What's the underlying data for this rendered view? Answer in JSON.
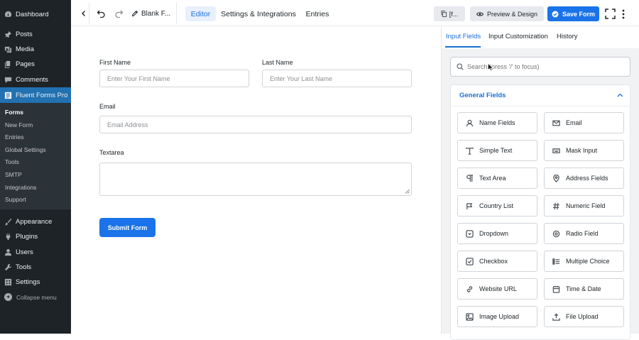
{
  "sidebar": {
    "items": [
      {
        "label": "Dashboard",
        "icon": "dashboard-icon"
      },
      {
        "label": "Posts",
        "icon": "pin-icon"
      },
      {
        "label": "Media",
        "icon": "media-icon"
      },
      {
        "label": "Pages",
        "icon": "pages-icon"
      },
      {
        "label": "Comments",
        "icon": "comments-icon"
      },
      {
        "label": "Fluent Forms Pro",
        "icon": "forms-icon"
      },
      {
        "label": "Appearance",
        "icon": "brush-icon"
      },
      {
        "label": "Plugins",
        "icon": "plugin-icon"
      },
      {
        "label": "Users",
        "icon": "users-icon"
      },
      {
        "label": "Tools",
        "icon": "wrench-icon"
      },
      {
        "label": "Settings",
        "icon": "settings-icon"
      }
    ],
    "submenu": [
      "Forms",
      "New Form",
      "Entries",
      "Global Settings",
      "Tools",
      "SMTP",
      "Integrations",
      "Support"
    ],
    "collapse_label": "Collapse menu"
  },
  "topbar": {
    "form_title": "Blank F...",
    "tabs": [
      "Editor",
      "Settings & Integrations",
      "Entries"
    ],
    "shortcode_label": "[f...",
    "preview_label": "Preview & Design",
    "save_label": "Save Form"
  },
  "form": {
    "first_name_label": "First Name",
    "first_name_placeholder": "Enter Your First Name",
    "last_name_label": "Last Name",
    "last_name_placeholder": "Enter Your Last Name",
    "email_label": "Email",
    "email_placeholder": "Email Address",
    "textarea_label": "Textarea",
    "submit_label": "Submit Form"
  },
  "panel": {
    "tabs": [
      "Input Fields",
      "Input Customization",
      "History"
    ],
    "search_placeholder": "Search (press '/' to focus)",
    "section_title": "General Fields",
    "fields": [
      {
        "label": "Name Fields",
        "icon": "user-icon"
      },
      {
        "label": "Email",
        "icon": "envelope-icon"
      },
      {
        "label": "Simple Text",
        "icon": "text-icon"
      },
      {
        "label": "Mask Input",
        "icon": "keyboard-icon"
      },
      {
        "label": "Text Area",
        "icon": "paragraph-icon"
      },
      {
        "label": "Address Fields",
        "icon": "location-pin-icon"
      },
      {
        "label": "Country List",
        "icon": "flag-icon"
      },
      {
        "label": "Numeric Field",
        "icon": "hash-icon"
      },
      {
        "label": "Dropdown",
        "icon": "dropdown-icon"
      },
      {
        "label": "Radio Field",
        "icon": "radio-icon"
      },
      {
        "label": "Checkbox",
        "icon": "checkbox-icon"
      },
      {
        "label": "Multiple Choice",
        "icon": "list-icon"
      },
      {
        "label": "Website URL",
        "icon": "link-icon"
      },
      {
        "label": "Time & Date",
        "icon": "calendar-icon"
      },
      {
        "label": "Image Upload",
        "icon": "image-icon"
      },
      {
        "label": "File Upload",
        "icon": "upload-icon"
      }
    ]
  }
}
